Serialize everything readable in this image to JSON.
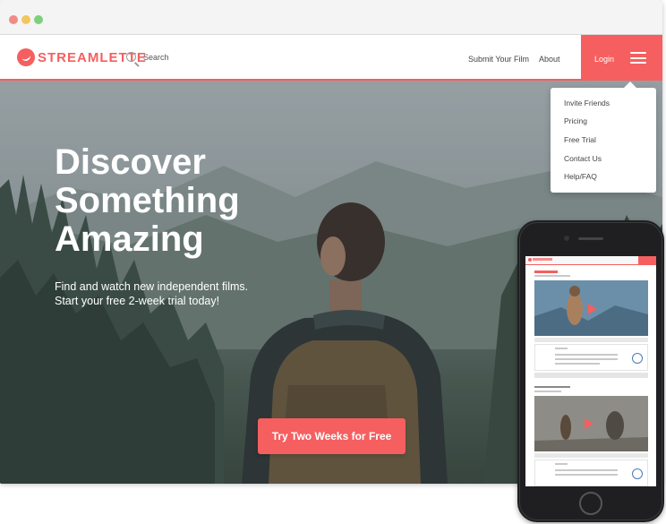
{
  "window": {
    "controls": [
      "close",
      "minimize",
      "maximize"
    ]
  },
  "brand": {
    "name": "STREAMLETTE",
    "icon": "streamlette-logo-icon",
    "accent_color": "#f55f5f"
  },
  "navbar": {
    "search": {
      "label": "Search",
      "icon": "search-icon"
    },
    "links": [
      {
        "label": "Submit Your Film"
      },
      {
        "label": "About"
      }
    ],
    "login_label": "Login",
    "menu_icon": "hamburger-menu-icon"
  },
  "dropdown": {
    "items": [
      {
        "label": "Invite Friends"
      },
      {
        "label": "Pricing"
      },
      {
        "label": "Free Trial"
      },
      {
        "label": "Contact Us"
      },
      {
        "label": "Help/FAQ"
      }
    ]
  },
  "hero": {
    "title_lines": [
      "Discover",
      "Something",
      "Amazing"
    ],
    "subtitle_lines": [
      "Find and watch new independent films.",
      "Start your free 2-week trial today!"
    ],
    "cta_label": "Try Two Weeks for Free"
  },
  "phone_preview": {
    "device": "smartphone",
    "icons": [
      "play-icon",
      "play-icon"
    ]
  }
}
